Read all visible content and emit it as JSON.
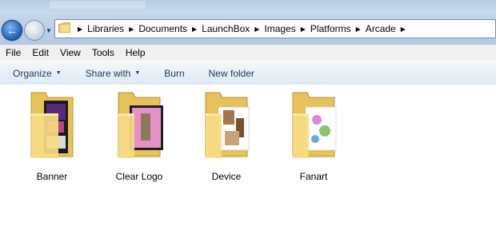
{
  "address_bar": {
    "crumbs": [
      "Libraries",
      "Documents",
      "LaunchBox",
      "Images",
      "Platforms",
      "Arcade"
    ]
  },
  "menu": {
    "items": [
      "File",
      "Edit",
      "View",
      "Tools",
      "Help"
    ]
  },
  "command_bar": {
    "organize": "Organize",
    "share_with": "Share with",
    "burn": "Burn",
    "new_folder": "New folder"
  },
  "folders": [
    {
      "name": "Banner",
      "icon": "folder-icon"
    },
    {
      "name": "Clear Logo",
      "icon": "folder-icon"
    },
    {
      "name": "Device",
      "icon": "folder-icon"
    },
    {
      "name": "Fanart",
      "icon": "folder-icon"
    }
  ],
  "colors": {
    "nav_bg": "#b4c9e1",
    "command_text": "#1e395b",
    "folder_yellow": "#f2d36b"
  }
}
